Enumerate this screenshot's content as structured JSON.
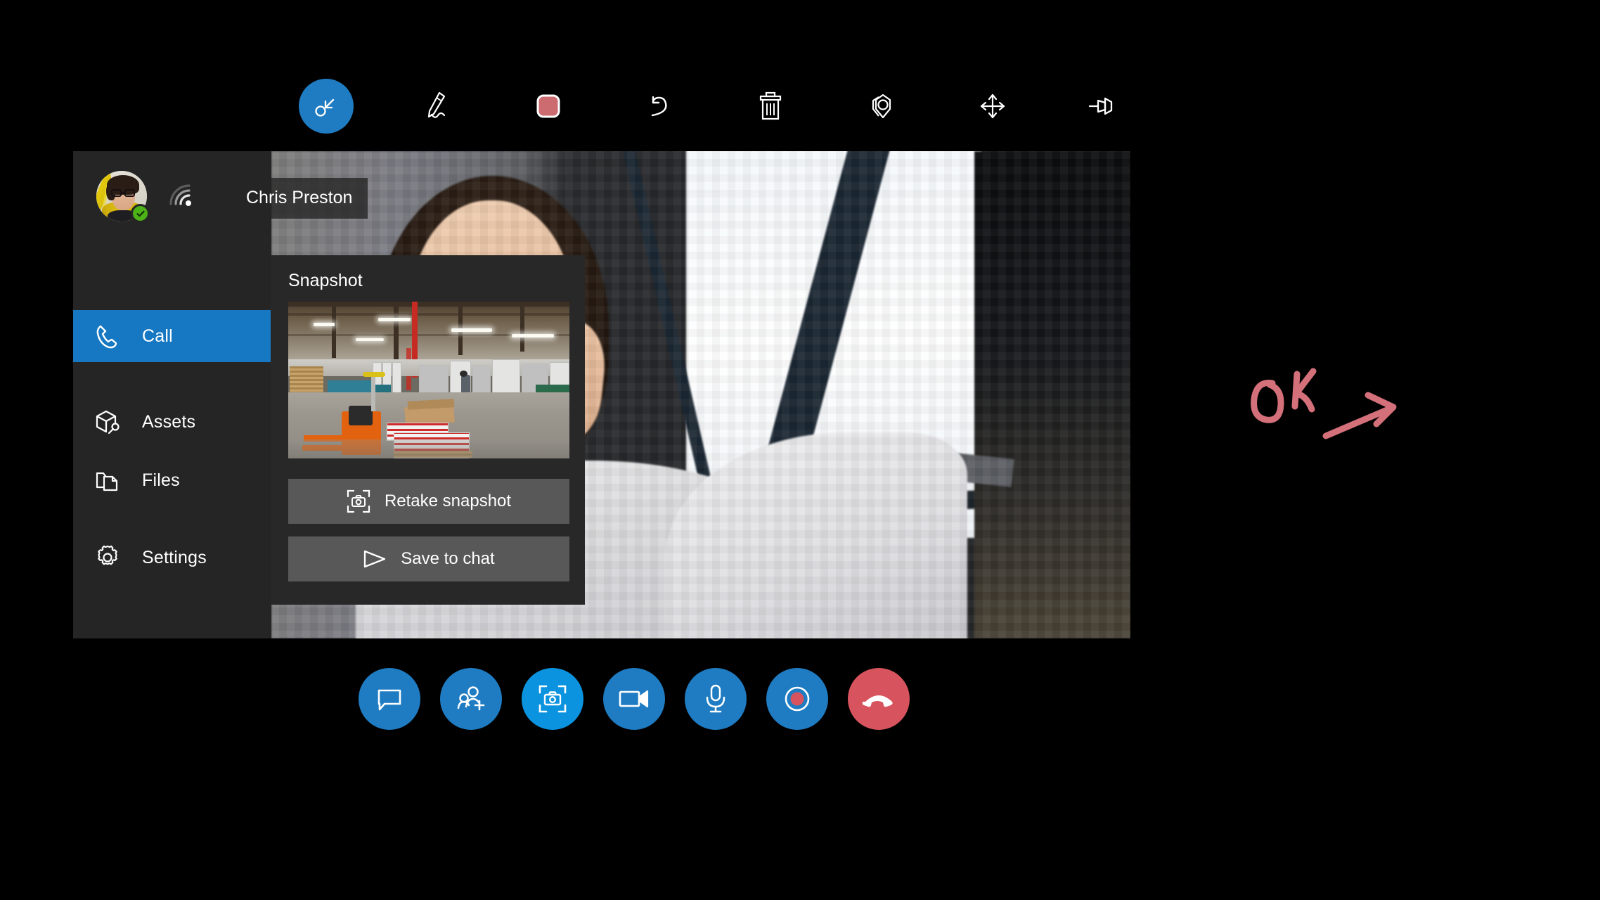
{
  "annotation_toolbar": {
    "tools": [
      {
        "name": "select-cursor-tool",
        "label": "Select",
        "active": true
      },
      {
        "name": "ink-pen-tool",
        "label": "Ink pen",
        "active": false
      },
      {
        "name": "ink-color-swatch",
        "label": "Ink color",
        "active": false,
        "color": "#cc6b70"
      },
      {
        "name": "undo-tool",
        "label": "Undo",
        "active": false
      },
      {
        "name": "delete-all-tool",
        "label": "Delete all ink",
        "active": false
      },
      {
        "name": "place-marker-tool",
        "label": "Place marker",
        "active": false
      },
      {
        "name": "move-toolbar-tool",
        "label": "Move toolbar",
        "active": false
      },
      {
        "name": "pin-toolbar-tool",
        "label": "Pin toolbar",
        "active": false
      }
    ]
  },
  "sidebar": {
    "presence_status": "available",
    "signal_label": "Connection signal",
    "items": [
      {
        "label": "Call",
        "icon": "phone-icon",
        "active": true
      },
      {
        "label": "Assets",
        "icon": "assets-box-icon",
        "active": false
      },
      {
        "label": "Files",
        "icon": "files-icon",
        "active": false
      },
      {
        "label": "Settings",
        "icon": "gear-icon",
        "active": false
      }
    ]
  },
  "video": {
    "participant_name": "Chris Preston"
  },
  "snapshot_panel": {
    "title": "Snapshot",
    "thumbnail_alt": "Warehouse floor with orange pallet jack and stacked printed boxes",
    "retake_label": "Retake snapshot",
    "save_label": "Save to chat"
  },
  "call_controls": [
    {
      "name": "chat-button",
      "label": "Chat",
      "style": "normal"
    },
    {
      "name": "add-participant-button",
      "label": "Add participant",
      "style": "normal"
    },
    {
      "name": "snapshot-button",
      "label": "Snapshot",
      "style": "bright"
    },
    {
      "name": "video-button",
      "label": "Video",
      "style": "normal"
    },
    {
      "name": "microphone-button",
      "label": "Microphone",
      "style": "normal"
    },
    {
      "name": "record-button",
      "label": "Record",
      "style": "normal"
    },
    {
      "name": "end-call-button",
      "label": "End call",
      "style": "danger"
    }
  ],
  "ink_annotation": {
    "text": "OK",
    "shape": "arrow pointing right",
    "color": "#d4707a"
  },
  "colors": {
    "accent_blue": "#1678c2",
    "bright_blue": "#0b93e0",
    "danger_red": "#d7545e",
    "sidebar_bg": "#252525",
    "panel_bg": "#282828",
    "button_bg": "#585858",
    "presence_green": "#4cb217",
    "ink_rose": "#d4707a"
  }
}
